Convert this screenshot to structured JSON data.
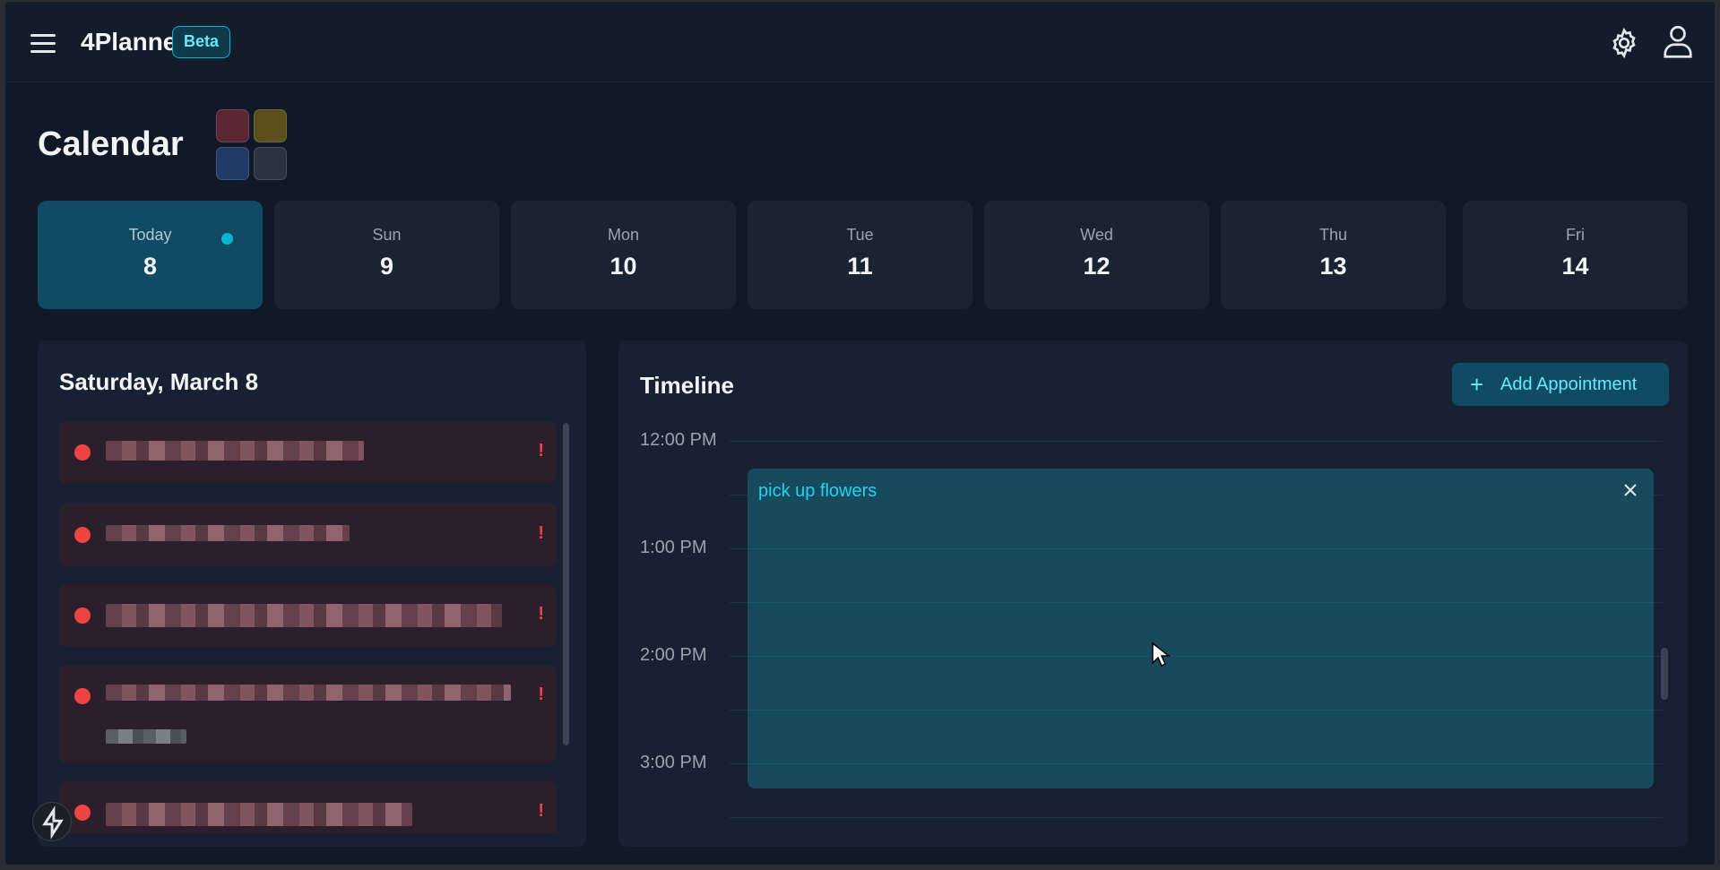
{
  "header": {
    "app_name": "4Planner",
    "badge": "Beta",
    "icons": [
      "menu-icon",
      "gear-icon",
      "user-icon"
    ]
  },
  "calendar": {
    "title": "Calendar",
    "swatch_colors": [
      "#5c2533",
      "#5b4f1b",
      "#1e3a66",
      "#2b3240"
    ],
    "days": [
      {
        "name": "Today",
        "num": "8"
      },
      {
        "name": "Sun",
        "num": "9"
      },
      {
        "name": "Mon",
        "num": "10"
      },
      {
        "name": "Tue",
        "num": "11"
      },
      {
        "name": "Wed",
        "num": "12"
      },
      {
        "name": "Thu",
        "num": "13"
      },
      {
        "name": "Fri",
        "num": "14"
      }
    ]
  },
  "tasks_panel": {
    "title": "Saturday, March 8",
    "priority_marker": "!"
  },
  "timeline": {
    "title": "Timeline",
    "add_button": "Add Appointment",
    "times": [
      "12:00 PM",
      "1:00 PM",
      "2:00 PM",
      "3:00 PM"
    ],
    "event": {
      "title": "pick up flowers"
    }
  },
  "colors": {
    "accent": "#06b6d4",
    "priority": "#ef4444",
    "background": "#111827"
  }
}
